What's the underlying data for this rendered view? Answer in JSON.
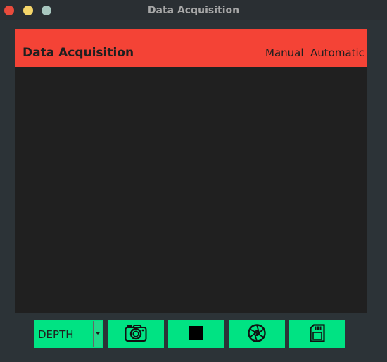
{
  "window": {
    "title": "Data Acquisition"
  },
  "appbar": {
    "title": "Data Acquisition",
    "tabs": [
      {
        "label": "Manual"
      },
      {
        "label": "Automatic"
      }
    ]
  },
  "toolbar": {
    "mode_select": {
      "value": "DEPTH"
    },
    "buttons": [
      {
        "icon": "camera-icon"
      },
      {
        "icon": "stop-icon"
      },
      {
        "icon": "aperture-icon"
      },
      {
        "icon": "sd-card-icon"
      }
    ]
  },
  "colors": {
    "appbar": "#f44336",
    "accent": "#00e383",
    "panel": "#202020",
    "window_bg": "#2c3337"
  }
}
